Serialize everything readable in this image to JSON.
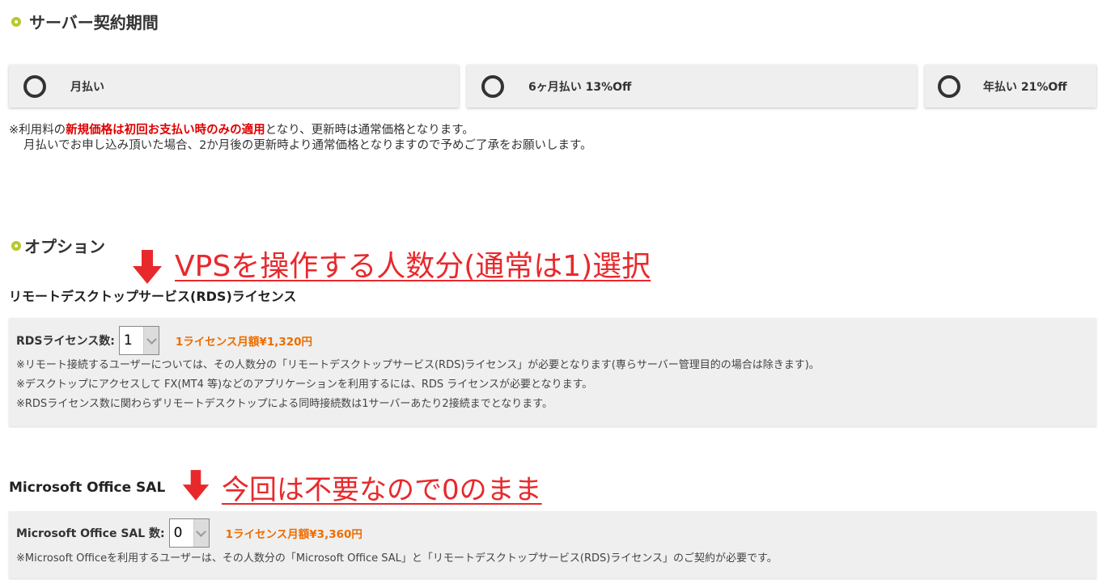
{
  "contract": {
    "title": "サーバー契約期間",
    "plans": [
      {
        "label": "月払い"
      },
      {
        "label": "6ヶ月払い 13%Off"
      },
      {
        "label": "年払い 21%Off"
      }
    ],
    "note1_prefix": "※利用料の",
    "note1_highlight": "新規価格は初回お支払い時のみの適用",
    "note1_suffix": "となり、更新時は通常価格となります。",
    "note2": "月払いでお申し込み頂いた場合、2か月後の更新時より通常価格となりますので予めご了承をお願いします。"
  },
  "options": {
    "title": "オプション",
    "rds": {
      "title": "リモートデスクトップサービス(RDS)ライセンス",
      "label": "RDSライセンス数:",
      "value": "1",
      "price": "1ライセンス月額¥1,320円",
      "notes": [
        "※リモート接続するユーザーについては、その人数分の「リモートデスクトップサービス(RDS)ライセンス」が必要となります(専らサーバー管理目的の場合は除きます)。",
        "※デスクトップにアクセスして FX(MT4 等)などのアプリケーションを利用するには、RDS ライセンスが必要となります。",
        "※RDSライセンス数に関わらずリモートデスクトップによる同時接続数は1サーバーあたり2接続までとなります。"
      ]
    },
    "office": {
      "title": "Microsoft Office SAL",
      "label": "Microsoft Office SAL 数:",
      "value": "0",
      "price": "1ライセンス月額¥3,360円",
      "note": "※Microsoft Officeを利用するユーザーは、その人数分の「Microsoft Office SAL」と「リモートデスクトップサービス(RDS)ライセンス」のご契約が必要です。"
    }
  },
  "annotations": {
    "rds": "VPSを操作する人数分(通常は1)選択",
    "office": "今回は不要なので0のまま"
  },
  "colors": {
    "accent_ring": "#b8c826",
    "highlight_red": "#e00000",
    "price_orange": "#ec6d00",
    "annotation_red": "#e8292c"
  }
}
